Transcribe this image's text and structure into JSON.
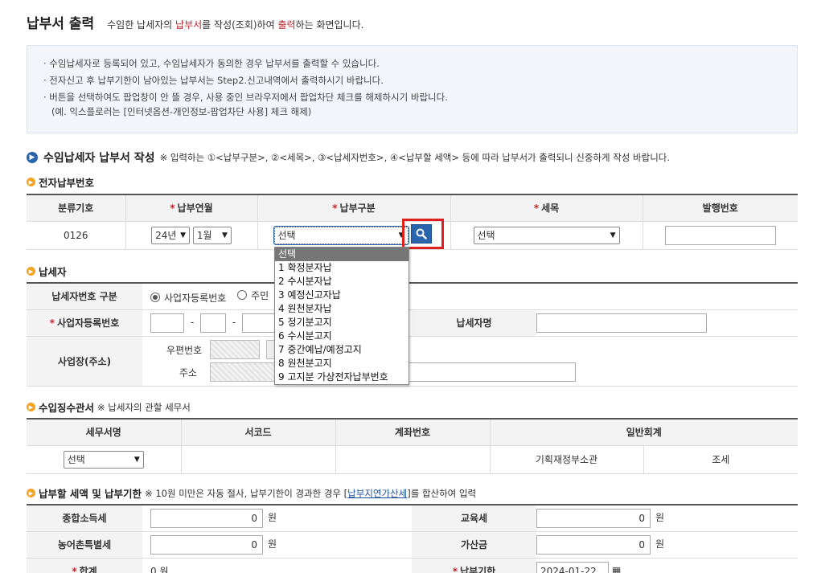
{
  "page": {
    "title": "납부서 출력",
    "desc_parts": [
      "수임한 납세자의 ",
      "납부서",
      "를 작성(조회)하여 ",
      "출력",
      "하는 화면입니다."
    ]
  },
  "notice": [
    "· 수임납세자로 등록되어 있고, 수임납세자가 동의한 경우 납부서를 출력할 수 있습니다.",
    "· 전자신고 후 납부기한이 남아있는 납부서는 Step2.신고내역에서 출력하시기 바랍니다.",
    "· 버튼을 선택하여도 팝업창이 안 뜰 경우, 사용 중인 브라우저에서 팝업차단 체크를 해제하시기 바랍니다.",
    "(예. 익스플로러는 [인터넷옵션-개인정보-팝업차단 사용] 체크 해제)"
  ],
  "section": {
    "title": "수임납세자 납부서 작성",
    "note": "※ 입력하는 ①<납부구분>, ②<세목>, ③<납세자번호>, ④<납부할 세액> 등에 따라 납부서가 출력되니 신중하게 작성 바랍니다."
  },
  "elec": {
    "title": "전자납부번호",
    "headers": [
      "분류기호",
      "납부연월",
      "납부구분",
      "세목",
      "발행번호"
    ],
    "code": "0126",
    "year": "24년",
    "month": "1월",
    "type_selected": "선택",
    "tax_selected": "선택",
    "issue_no": ""
  },
  "dropdown": {
    "options": [
      "선택",
      "1 확정분자납",
      "2 수시분자납",
      "3 예정신고자납",
      "4 원천분자납",
      "5 정기분고지",
      "6 수시분고지",
      "7 중간예납/예정고지",
      "8 원천분고지",
      "9 고지분 가상전자납부번호"
    ]
  },
  "payer": {
    "title": "납세자",
    "id_type_label": "납세자번호 구분",
    "radio1": "사업자등록번호",
    "radio2": "주민",
    "biz_label": "사업자등록번호",
    "name_label": "납세자명",
    "addr_label": "사업장(주소)",
    "zip_label": "우편번호",
    "addr_sub": "주소",
    "dash": "-"
  },
  "office": {
    "title": "수입징수관서",
    "note": "※ 납세자의 관할 세무서",
    "headers": [
      "세무서명",
      "서코드",
      "계좌번호",
      "일반회계"
    ],
    "selected": "선택",
    "account_type": "기획재정부소관",
    "tax_kind": "조세"
  },
  "amount": {
    "title": "납부할 세액 및 납부기한",
    "note_pre": "※ 10원 미만은 자동 절사, 납부기한이 경과한 경우 [",
    "note_link": "납부지연가산세",
    "note_post": "]를 합산하여 입력",
    "income_tax": "종합소득세",
    "edu_tax": "교육세",
    "rural_tax": "농어촌특별세",
    "penalty": "가산금",
    "total": "합계",
    "due": "납부기한",
    "due_date": "2024-01-22",
    "zero": "0",
    "won": "원"
  }
}
